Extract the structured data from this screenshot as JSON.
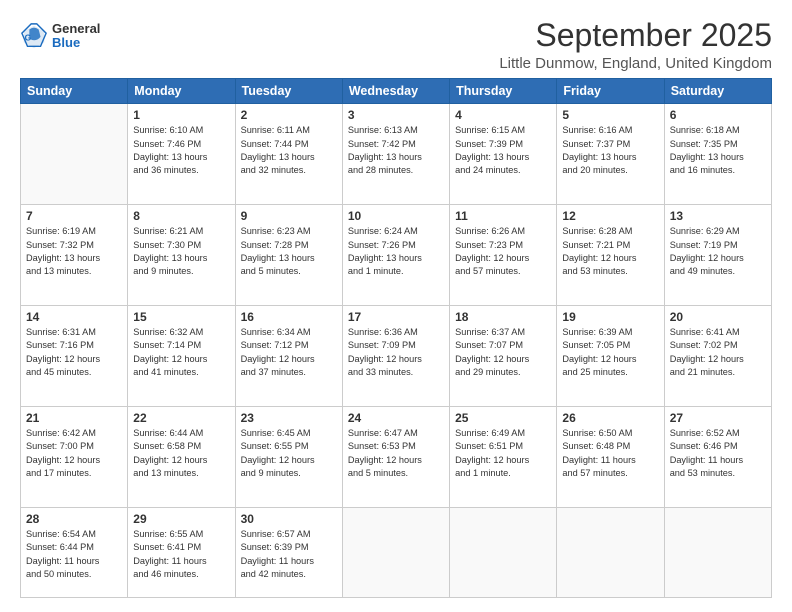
{
  "header": {
    "logo": {
      "general": "General",
      "blue": "Blue"
    },
    "title": "September 2025",
    "location": "Little Dunmow, England, United Kingdom"
  },
  "weekdays": [
    "Sunday",
    "Monday",
    "Tuesday",
    "Wednesday",
    "Thursday",
    "Friday",
    "Saturday"
  ],
  "weeks": [
    [
      {
        "day": "",
        "info": ""
      },
      {
        "day": "1",
        "info": "Sunrise: 6:10 AM\nSunset: 7:46 PM\nDaylight: 13 hours\nand 36 minutes."
      },
      {
        "day": "2",
        "info": "Sunrise: 6:11 AM\nSunset: 7:44 PM\nDaylight: 13 hours\nand 32 minutes."
      },
      {
        "day": "3",
        "info": "Sunrise: 6:13 AM\nSunset: 7:42 PM\nDaylight: 13 hours\nand 28 minutes."
      },
      {
        "day": "4",
        "info": "Sunrise: 6:15 AM\nSunset: 7:39 PM\nDaylight: 13 hours\nand 24 minutes."
      },
      {
        "day": "5",
        "info": "Sunrise: 6:16 AM\nSunset: 7:37 PM\nDaylight: 13 hours\nand 20 minutes."
      },
      {
        "day": "6",
        "info": "Sunrise: 6:18 AM\nSunset: 7:35 PM\nDaylight: 13 hours\nand 16 minutes."
      }
    ],
    [
      {
        "day": "7",
        "info": "Sunrise: 6:19 AM\nSunset: 7:32 PM\nDaylight: 13 hours\nand 13 minutes."
      },
      {
        "day": "8",
        "info": "Sunrise: 6:21 AM\nSunset: 7:30 PM\nDaylight: 13 hours\nand 9 minutes."
      },
      {
        "day": "9",
        "info": "Sunrise: 6:23 AM\nSunset: 7:28 PM\nDaylight: 13 hours\nand 5 minutes."
      },
      {
        "day": "10",
        "info": "Sunrise: 6:24 AM\nSunset: 7:26 PM\nDaylight: 13 hours\nand 1 minute."
      },
      {
        "day": "11",
        "info": "Sunrise: 6:26 AM\nSunset: 7:23 PM\nDaylight: 12 hours\nand 57 minutes."
      },
      {
        "day": "12",
        "info": "Sunrise: 6:28 AM\nSunset: 7:21 PM\nDaylight: 12 hours\nand 53 minutes."
      },
      {
        "day": "13",
        "info": "Sunrise: 6:29 AM\nSunset: 7:19 PM\nDaylight: 12 hours\nand 49 minutes."
      }
    ],
    [
      {
        "day": "14",
        "info": "Sunrise: 6:31 AM\nSunset: 7:16 PM\nDaylight: 12 hours\nand 45 minutes."
      },
      {
        "day": "15",
        "info": "Sunrise: 6:32 AM\nSunset: 7:14 PM\nDaylight: 12 hours\nand 41 minutes."
      },
      {
        "day": "16",
        "info": "Sunrise: 6:34 AM\nSunset: 7:12 PM\nDaylight: 12 hours\nand 37 minutes."
      },
      {
        "day": "17",
        "info": "Sunrise: 6:36 AM\nSunset: 7:09 PM\nDaylight: 12 hours\nand 33 minutes."
      },
      {
        "day": "18",
        "info": "Sunrise: 6:37 AM\nSunset: 7:07 PM\nDaylight: 12 hours\nand 29 minutes."
      },
      {
        "day": "19",
        "info": "Sunrise: 6:39 AM\nSunset: 7:05 PM\nDaylight: 12 hours\nand 25 minutes."
      },
      {
        "day": "20",
        "info": "Sunrise: 6:41 AM\nSunset: 7:02 PM\nDaylight: 12 hours\nand 21 minutes."
      }
    ],
    [
      {
        "day": "21",
        "info": "Sunrise: 6:42 AM\nSunset: 7:00 PM\nDaylight: 12 hours\nand 17 minutes."
      },
      {
        "day": "22",
        "info": "Sunrise: 6:44 AM\nSunset: 6:58 PM\nDaylight: 12 hours\nand 13 minutes."
      },
      {
        "day": "23",
        "info": "Sunrise: 6:45 AM\nSunset: 6:55 PM\nDaylight: 12 hours\nand 9 minutes."
      },
      {
        "day": "24",
        "info": "Sunrise: 6:47 AM\nSunset: 6:53 PM\nDaylight: 12 hours\nand 5 minutes."
      },
      {
        "day": "25",
        "info": "Sunrise: 6:49 AM\nSunset: 6:51 PM\nDaylight: 12 hours\nand 1 minute."
      },
      {
        "day": "26",
        "info": "Sunrise: 6:50 AM\nSunset: 6:48 PM\nDaylight: 11 hours\nand 57 minutes."
      },
      {
        "day": "27",
        "info": "Sunrise: 6:52 AM\nSunset: 6:46 PM\nDaylight: 11 hours\nand 53 minutes."
      }
    ],
    [
      {
        "day": "28",
        "info": "Sunrise: 6:54 AM\nSunset: 6:44 PM\nDaylight: 11 hours\nand 50 minutes."
      },
      {
        "day": "29",
        "info": "Sunrise: 6:55 AM\nSunset: 6:41 PM\nDaylight: 11 hours\nand 46 minutes."
      },
      {
        "day": "30",
        "info": "Sunrise: 6:57 AM\nSunset: 6:39 PM\nDaylight: 11 hours\nand 42 minutes."
      },
      {
        "day": "",
        "info": ""
      },
      {
        "day": "",
        "info": ""
      },
      {
        "day": "",
        "info": ""
      },
      {
        "day": "",
        "info": ""
      }
    ]
  ]
}
